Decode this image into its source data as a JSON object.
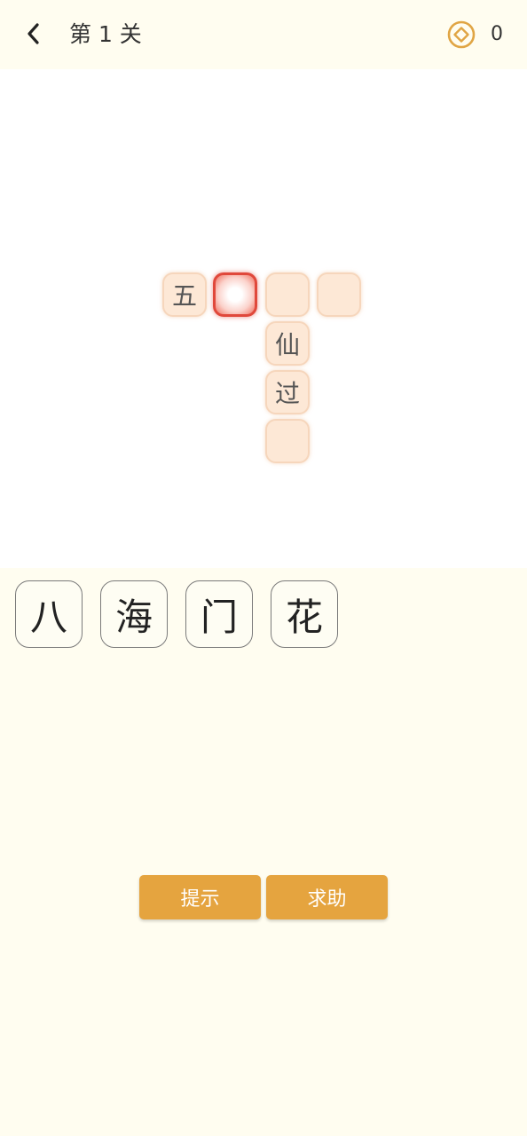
{
  "header": {
    "title": "第 1 关",
    "coins": "0"
  },
  "board": {
    "cells": [
      {
        "char": "五"
      },
      {
        "char": ""
      },
      {
        "char": ""
      },
      {
        "char": ""
      },
      {
        "char": "仙"
      },
      {
        "char": "过"
      },
      {
        "char": ""
      }
    ]
  },
  "candidates": [
    "八",
    "海",
    "门",
    "花"
  ],
  "actions": {
    "hint_label": "提示",
    "help_label": "求助"
  },
  "colors": {
    "background": "#fffdf0",
    "cell_fill": "#fde8d6",
    "selected_border": "#e0483b",
    "button": "#e5a43f",
    "coin": "#e0a544"
  }
}
